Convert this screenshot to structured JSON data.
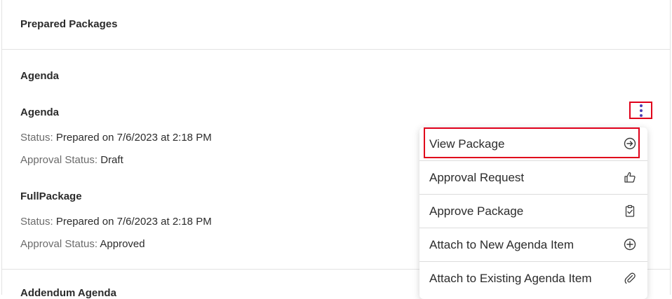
{
  "header": {
    "title": "Prepared Packages"
  },
  "sections": [
    {
      "title": "Agenda",
      "packages": [
        {
          "name": "Agenda",
          "status_label": "Status:",
          "status_value": "Prepared on 7/6/2023 at 2:18 PM",
          "approval_label": "Approval Status:",
          "approval_value": "Draft"
        },
        {
          "name": "FullPackage",
          "status_label": "Status:",
          "status_value": "Prepared on 7/6/2023 at 2:18 PM",
          "approval_label": "Approval Status:",
          "approval_value": "Approved"
        }
      ]
    },
    {
      "title": "Addendum Agenda"
    }
  ],
  "menu": {
    "items": [
      {
        "label": "View Package",
        "icon": "arrow-circle-right-icon"
      },
      {
        "label": "Approval Request",
        "icon": "thumbs-up-icon"
      },
      {
        "label": "Approve Package",
        "icon": "clipboard-check-icon"
      },
      {
        "label": "Attach to New Agenda Item",
        "icon": "plus-circle-icon"
      },
      {
        "label": "Attach to Existing Agenda Item",
        "icon": "paperclip-icon"
      }
    ]
  },
  "colors": {
    "highlight": "#e0001b",
    "kebab": "#4b3fb5"
  }
}
